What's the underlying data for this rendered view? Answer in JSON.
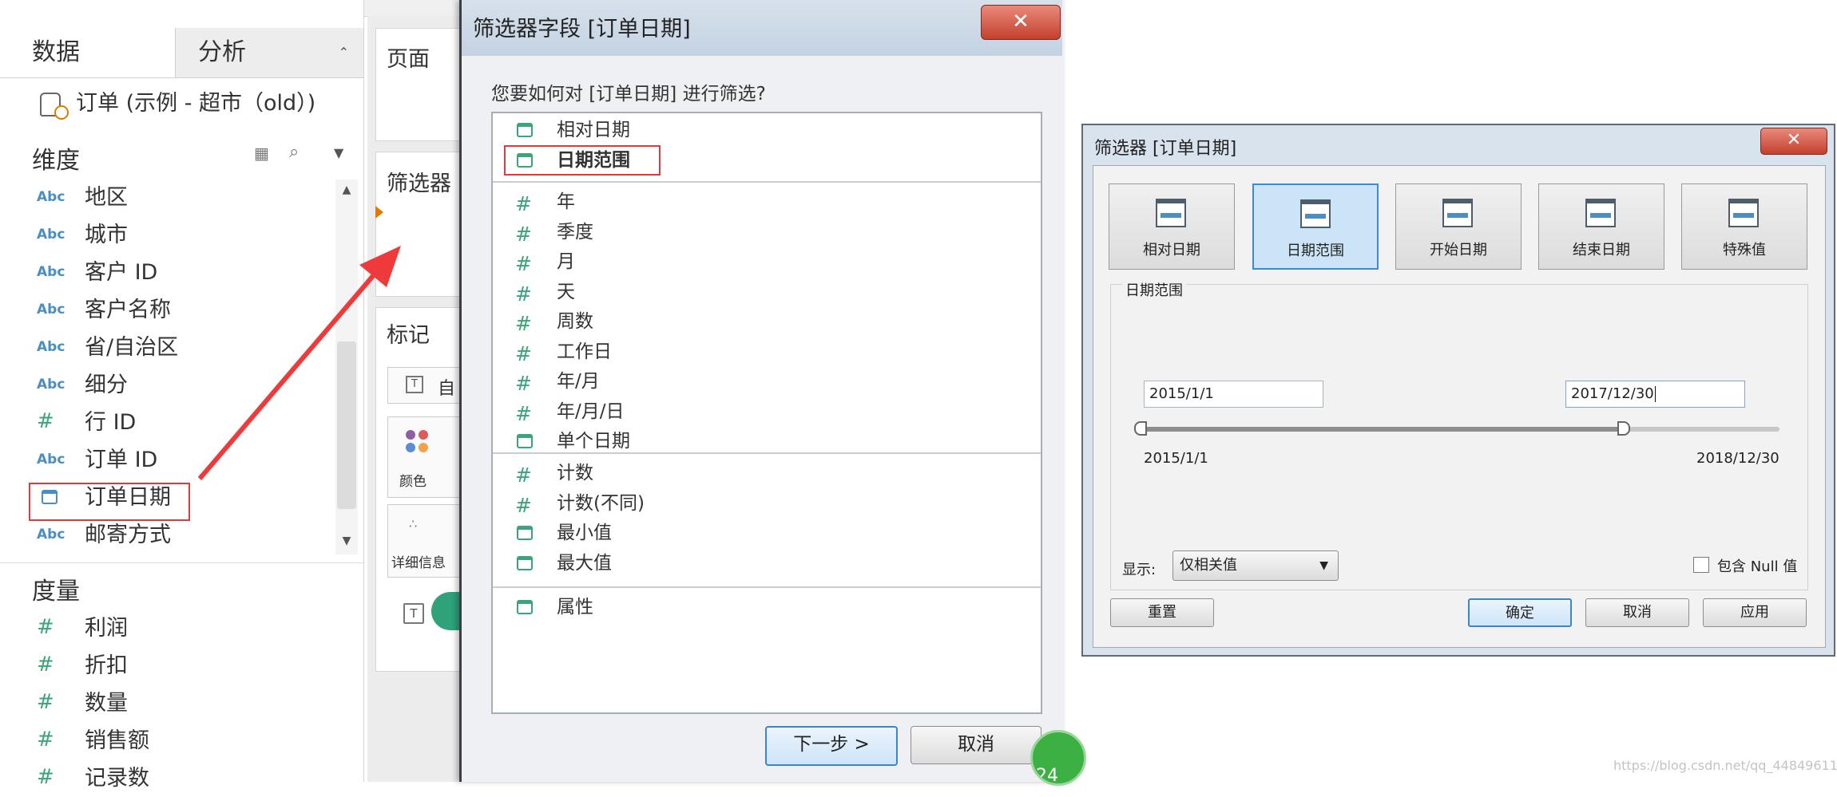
{
  "data_pane": {
    "tabs": {
      "data": "数据",
      "analysis": "分析",
      "analysis_arrow": "⌃"
    },
    "datasource": "订单 (示例 - 超市（old）)",
    "dimensions_header": "维度",
    "dimensions": [
      {
        "type": "Abc",
        "label": "地区"
      },
      {
        "type": "Abc",
        "label": "城市"
      },
      {
        "type": "Abc",
        "label": "客户 ID"
      },
      {
        "type": "Abc",
        "label": "客户名称"
      },
      {
        "type": "Abc",
        "label": "省/自治区"
      },
      {
        "type": "Abc",
        "label": "细分"
      },
      {
        "type": "#",
        "label": "行 ID"
      },
      {
        "type": "Abc",
        "label": "订单 ID"
      },
      {
        "type": "calendar",
        "label": "订单日期"
      },
      {
        "type": "Abc",
        "label": "邮寄方式"
      }
    ],
    "measures_header": "度量",
    "measures": [
      {
        "type": "#",
        "label": "利润"
      },
      {
        "type": "#",
        "label": "折扣"
      },
      {
        "type": "#",
        "label": "数量"
      },
      {
        "type": "#",
        "label": "销售额"
      },
      {
        "type": "#",
        "label": "记录数"
      }
    ]
  },
  "shelves": {
    "pages": "页面",
    "filters": "筛选器",
    "marks": "标记",
    "mark_type": "自",
    "color": "颜色",
    "detail": "详细信息"
  },
  "field_dialog": {
    "title": "筛选器字段 [订单日期]",
    "close": "✕",
    "question": "您要如何对 [订单日期] 进行筛选?",
    "groups": [
      [
        {
          "icon": "calendar",
          "label": "相对日期"
        },
        {
          "icon": "calendar",
          "label": "日期范围"
        }
      ],
      [
        {
          "icon": "#",
          "label": "年"
        },
        {
          "icon": "#",
          "label": "季度"
        },
        {
          "icon": "#",
          "label": "月"
        },
        {
          "icon": "#",
          "label": "天"
        },
        {
          "icon": "#",
          "label": "周数"
        },
        {
          "icon": "#",
          "label": "工作日"
        },
        {
          "icon": "#",
          "label": "年/月"
        },
        {
          "icon": "#",
          "label": "年/月/日"
        },
        {
          "icon": "calendar",
          "label": "单个日期"
        }
      ],
      [
        {
          "icon": "#",
          "label": "计数"
        },
        {
          "icon": "#",
          "label": "计数(不同)"
        },
        {
          "icon": "calendar",
          "label": "最小值"
        },
        {
          "icon": "calendar",
          "label": "最大值"
        }
      ],
      [
        {
          "icon": "calendar",
          "label": "属性"
        }
      ]
    ],
    "next_button": "下一步 >",
    "cancel_button": "取消",
    "badge": "24"
  },
  "filter_dialog": {
    "title": "筛选器 [订单日期]",
    "close": "✕",
    "modes": [
      {
        "label": "相对日期",
        "selected": false
      },
      {
        "label": "日期范围",
        "selected": true
      },
      {
        "label": "开始日期",
        "selected": false
      },
      {
        "label": "结束日期",
        "selected": false
      },
      {
        "label": "特殊值",
        "selected": false
      }
    ],
    "range_group_label": "日期范围",
    "start_date": "2015/1/1",
    "end_date": "2017/12/30",
    "slider_min": "2015/1/1",
    "slider_max": "2018/12/30",
    "show_label": "显示:",
    "show_value": "仅相关值",
    "include_null_label": "包含 Null 值",
    "reset_button": "重置",
    "ok_button": "确定",
    "cancel_button": "取消",
    "apply_button": "应用"
  },
  "watermark": "https://blog.csdn.net/qq_44849611",
  "colors": {
    "highlight_red": "#e2393f",
    "selection_blue": "#cce4f7",
    "dimension_blue": "#4a8ec2",
    "measure_green": "#3aa57a"
  }
}
